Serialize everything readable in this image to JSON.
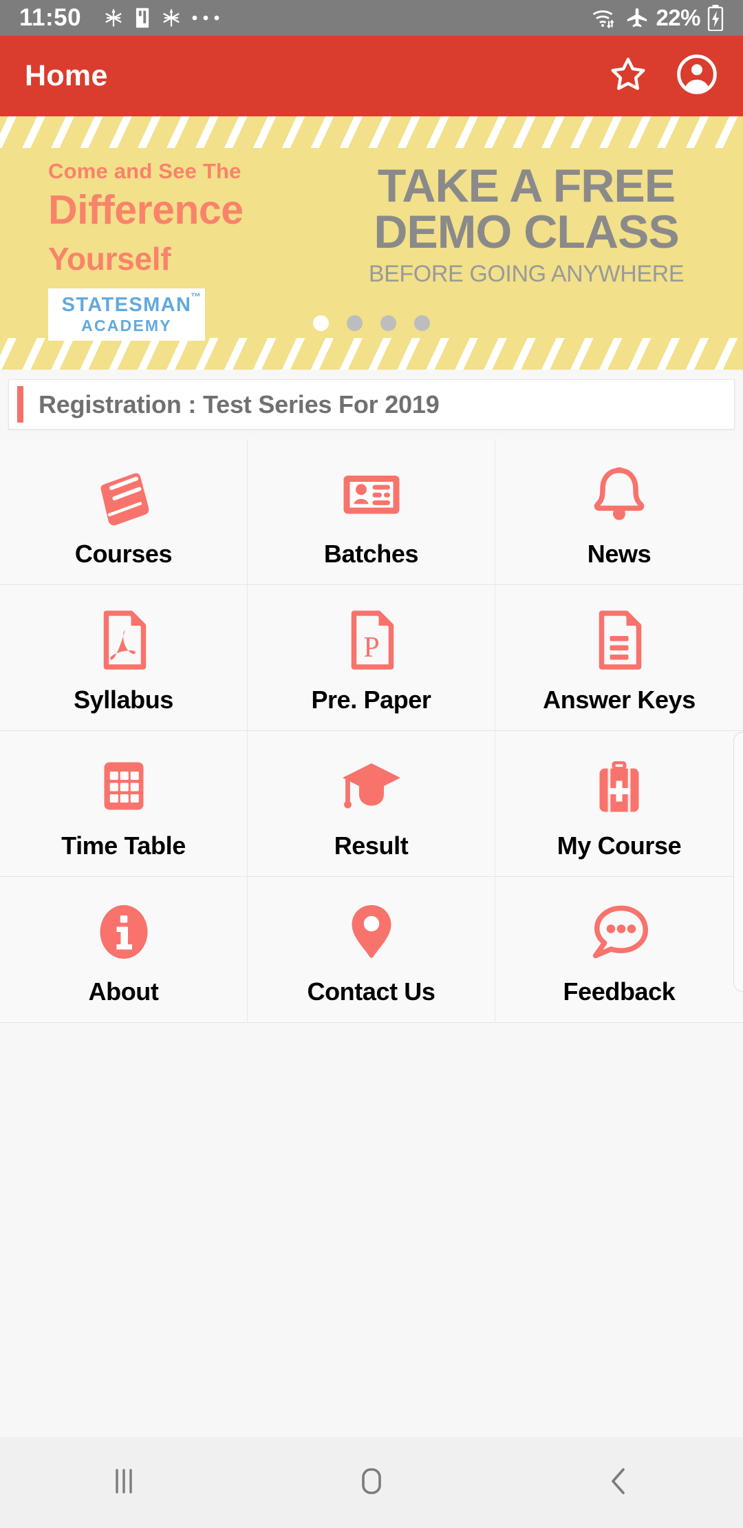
{
  "status_bar": {
    "time": "11:50",
    "left_icons": [
      "notification-snowflake-icon",
      "notification-card-icon",
      "notification-snowflake-icon",
      "more-dots-icon"
    ],
    "right_icons": [
      "wifi-icon",
      "airplane-mode-icon"
    ],
    "battery_text": "22%",
    "battery_icon": "battery-charging-icon"
  },
  "app_bar": {
    "title": "Home",
    "favorite_icon": "star-outline-icon",
    "profile_icon": "account-circle-icon",
    "background_color": "#da3c2d"
  },
  "banner": {
    "come_and_see": "Come and See The",
    "difference": "Difference",
    "yourself": "Yourself",
    "logo_line1": "STATESMAN",
    "logo_line2": "ACADEMY",
    "logo_tm": "™",
    "headline_line1": "TAKE A FREE",
    "headline_line2": "DEMO CLASS",
    "subhead": "BEFORE GOING ANYWHERE",
    "background_color": "#f2e08a",
    "accent_color": "#f8836a",
    "dots": {
      "count": 4,
      "active_index": 0
    }
  },
  "registration": {
    "text": "Registration : Test Series For 2019",
    "accent_color": "#f4716a"
  },
  "grid": {
    "accent_color": "#f8736c",
    "items": [
      {
        "label": "Courses",
        "icon": "book-icon"
      },
      {
        "label": "Batches",
        "icon": "id-card-icon"
      },
      {
        "label": "News",
        "icon": "bell-icon"
      },
      {
        "label": "Syllabus",
        "icon": "pdf-file-icon"
      },
      {
        "label": "Pre. Paper",
        "icon": "paper-file-icon"
      },
      {
        "label": "Answer Keys",
        "icon": "document-lines-icon"
      },
      {
        "label": "Time Table",
        "icon": "table-grid-icon"
      },
      {
        "label": "Result",
        "icon": "graduation-cap-icon"
      },
      {
        "label": "My Course",
        "icon": "briefcase-plus-icon"
      },
      {
        "label": "About",
        "icon": "info-circle-icon"
      },
      {
        "label": "Contact Us",
        "icon": "map-pin-icon"
      },
      {
        "label": "Feedback",
        "icon": "chat-bubble-icon"
      }
    ]
  },
  "nav_bar": {
    "recents_icon": "recents-icon",
    "home_icon": "home-square-icon",
    "back_icon": "back-chevron-icon"
  }
}
